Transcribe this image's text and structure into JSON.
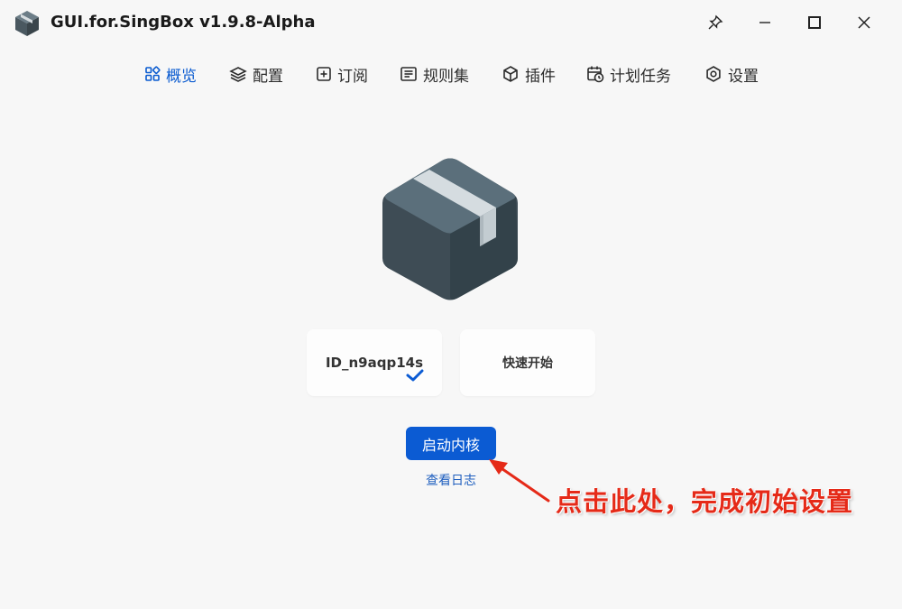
{
  "window": {
    "title": "GUI.for.SingBox v1.9.8-Alpha",
    "controls": [
      "pin-icon",
      "minimize-icon",
      "maximize-icon",
      "close-icon"
    ]
  },
  "nav": {
    "items": [
      {
        "label": "概览",
        "icon": "overview-grid-icon",
        "active": true
      },
      {
        "label": "配置",
        "icon": "layers-icon",
        "active": false
      },
      {
        "label": "订阅",
        "icon": "subscribe-plus-icon",
        "active": false
      },
      {
        "label": "规则集",
        "icon": "ruleset-icon",
        "active": false
      },
      {
        "label": "插件",
        "icon": "plugin-cube-icon",
        "active": false
      },
      {
        "label": "计划任务",
        "icon": "calendar-clock-icon",
        "active": false
      },
      {
        "label": "设置",
        "icon": "settings-gear-icon",
        "active": false
      }
    ]
  },
  "main": {
    "hero_icon": "package-box-icon",
    "profile_card": {
      "label": "ID_n9aqp14s",
      "selected": true
    },
    "quick_start_card": {
      "label": "快速开始"
    },
    "start_button": "启动内核",
    "view_logs": "查看日志"
  },
  "annotation": {
    "text": "点击此处，完成初始设置",
    "color": "#e52a18"
  },
  "colors": {
    "accent": "#0b5bd3",
    "background": "#f7f7f7",
    "box_dark": "#3e4c55",
    "box_light": "#5a6e79",
    "tape": "#d3dade"
  }
}
